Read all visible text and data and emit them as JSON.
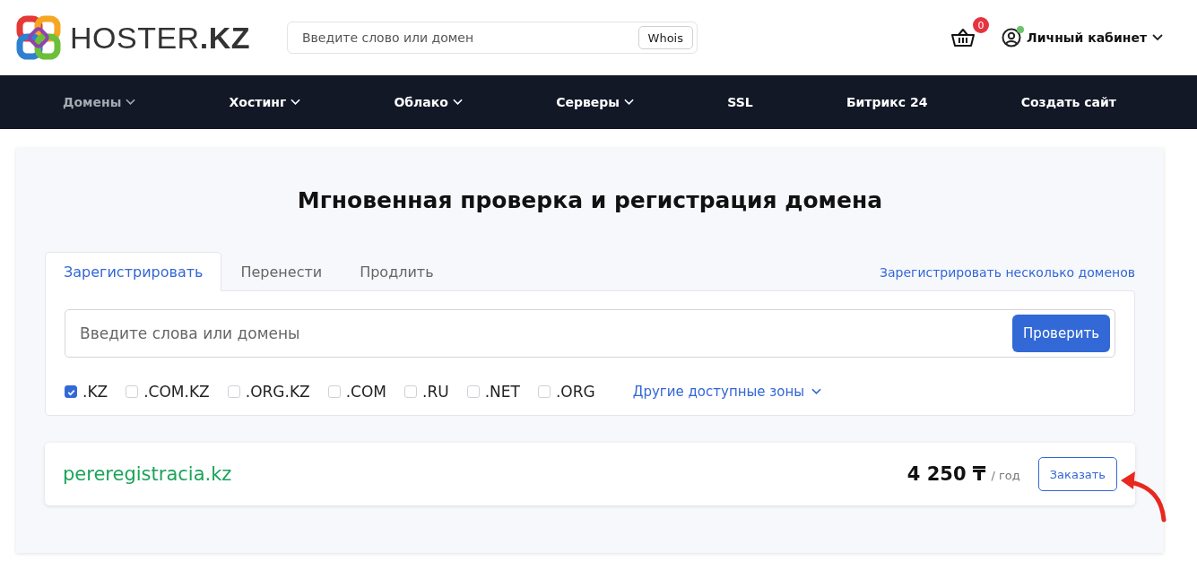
{
  "header": {
    "logo_text": "HOSTER**.KZ**",
    "search": {
      "placeholder": "Введите слово или домен",
      "button": "Whois"
    },
    "cart_count": "0",
    "account": {
      "label": "Личный кабинет",
      "online": true
    }
  },
  "nav": [
    {
      "label": "Домены",
      "dropdown": true,
      "selected": true
    },
    {
      "label": "Хостинг",
      "dropdown": true,
      "selected": false
    },
    {
      "label": "Облако",
      "dropdown": true,
      "selected": false
    },
    {
      "label": "Серверы",
      "dropdown": true,
      "selected": false
    },
    {
      "label": "SSL",
      "dropdown": false,
      "selected": false
    },
    {
      "label": "Битрикс 24",
      "dropdown": false,
      "selected": false
    },
    {
      "label": "Создать сайт",
      "dropdown": false,
      "selected": false
    }
  ],
  "title": "Мгновенная проверка и регистрация домена",
  "tabs": [
    {
      "label": "Зарегистрировать",
      "selected": true
    },
    {
      "label": "Перенести",
      "selected": false
    },
    {
      "label": "Продлить",
      "selected": false
    }
  ],
  "bulk_link": "Зарегистрировать несколько доменов",
  "domain_search": {
    "placeholder": "Введите слова или домены",
    "button": "Проверить"
  },
  "zones": [
    {
      "label": ".KZ",
      "checked": true
    },
    {
      "label": ".COM.KZ",
      "checked": false
    },
    {
      "label": ".ORG.KZ",
      "checked": false
    },
    {
      "label": ".COM",
      "checked": false
    },
    {
      "label": ".RU",
      "checked": false
    },
    {
      "label": ".NET",
      "checked": false
    },
    {
      "label": ".ORG",
      "checked": false
    }
  ],
  "other_zones": "Другие доступные зоны",
  "result": {
    "domain": "pereregistracia.kz",
    "price": "4 250 ₸",
    "period": "/ год",
    "button": "Заказать"
  }
}
